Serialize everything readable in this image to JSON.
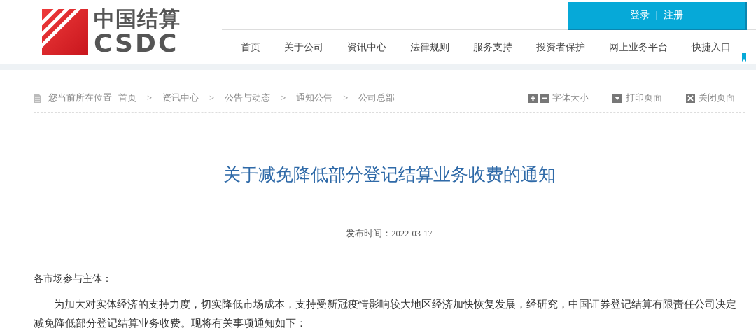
{
  "logo": {
    "name": "中国结算",
    "abbr": "CSDC"
  },
  "account": {
    "login": "登录",
    "separator": "|",
    "register": "注册"
  },
  "nav": [
    {
      "label": "首页"
    },
    {
      "label": "关于公司"
    },
    {
      "label": "资讯中心"
    },
    {
      "label": "法律规则"
    },
    {
      "label": "服务支持"
    },
    {
      "label": "投资者保护"
    },
    {
      "label": "网上业务平台"
    },
    {
      "label": "快捷入口"
    }
  ],
  "breadcrumb": {
    "prefix": "您当前所在位置",
    "items": [
      "首页",
      "资讯中心",
      "公告与动态",
      "通知公告",
      "公司总部"
    ],
    "separator": ">"
  },
  "tools": [
    {
      "kind": "font-size",
      "label": "字体大小"
    },
    {
      "kind": "print",
      "label": "打印页面"
    },
    {
      "kind": "close",
      "label": "关闭页面"
    }
  ],
  "article": {
    "title": "关于减免降低部分登记结算业务收费的通知",
    "date": "发布时间：2022-03-17",
    "greeting": "各市场参与主体：",
    "paragraphs": [
      "为加大对实体经济的支持力度，切实降低市场成本，支持受新冠疫情影响较大地区经济加快恢复发展，经研究，中国证券登记结算有限责任公司决定减免降低部分登记结算业务收费。现将有关事项通知如下："
    ]
  }
}
